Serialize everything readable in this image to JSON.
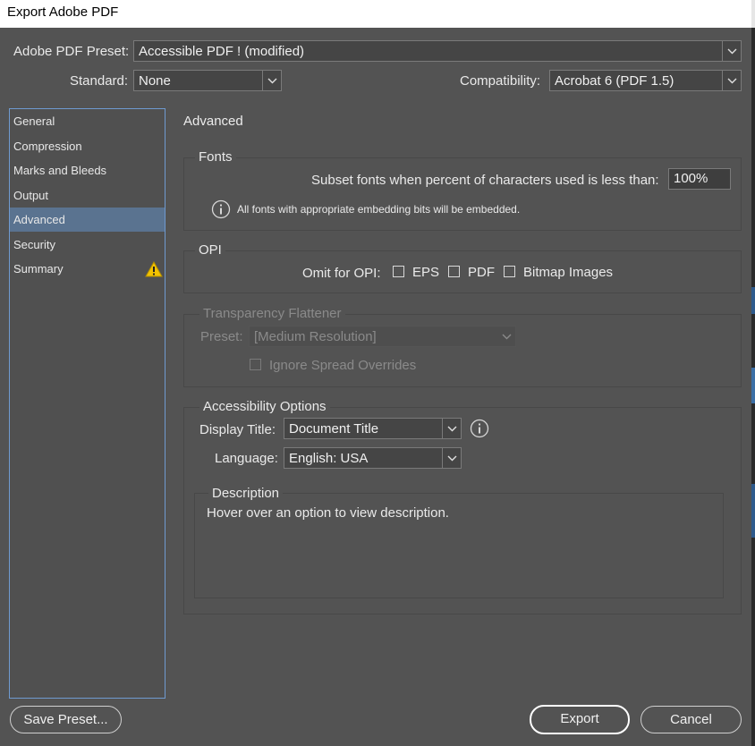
{
  "window": {
    "title": "Export Adobe PDF"
  },
  "preset": {
    "label": "Adobe PDF Preset:",
    "value": "Accessible PDF ! (modified)"
  },
  "standard": {
    "label": "Standard:",
    "value": "None"
  },
  "compatibility": {
    "label": "Compatibility:",
    "value": "Acrobat 6 (PDF 1.5)"
  },
  "sidebar": {
    "items": [
      {
        "label": "General"
      },
      {
        "label": "Compression"
      },
      {
        "label": "Marks and Bleeds"
      },
      {
        "label": "Output"
      },
      {
        "label": "Advanced",
        "active": true
      },
      {
        "label": "Security"
      },
      {
        "label": "Summary",
        "icon": "warning-icon"
      }
    ]
  },
  "page": {
    "title": "Advanced"
  },
  "fonts": {
    "legend": "Fonts",
    "subset_label": "Subset fonts when percent of characters used is less than:",
    "subset_value": "100%",
    "info_text": "All fonts with appropriate embedding bits will be embedded."
  },
  "opi": {
    "legend": "OPI",
    "omit_label": "Omit for OPI:",
    "eps": "EPS",
    "pdf": "PDF",
    "bitmap": "Bitmap Images"
  },
  "transparency": {
    "legend": "Transparency Flattener",
    "preset_label": "Preset:",
    "preset_value": "[Medium Resolution]",
    "ignore_label": "Ignore Spread Overrides"
  },
  "accessibility": {
    "legend": "Accessibility Options",
    "display_title_label": "Display Title:",
    "display_title_value": "Document Title",
    "language_label": "Language:",
    "language_value": "English: USA"
  },
  "description": {
    "legend": "Description",
    "text": "Hover over an option to view description."
  },
  "buttons": {
    "save_preset": "Save Preset...",
    "export": "Export",
    "cancel": "Cancel"
  },
  "colors": {
    "background": "#535353",
    "selection": "#5a7390",
    "sidebar_border": "#6f9ad0",
    "warning": "#f2c200"
  }
}
